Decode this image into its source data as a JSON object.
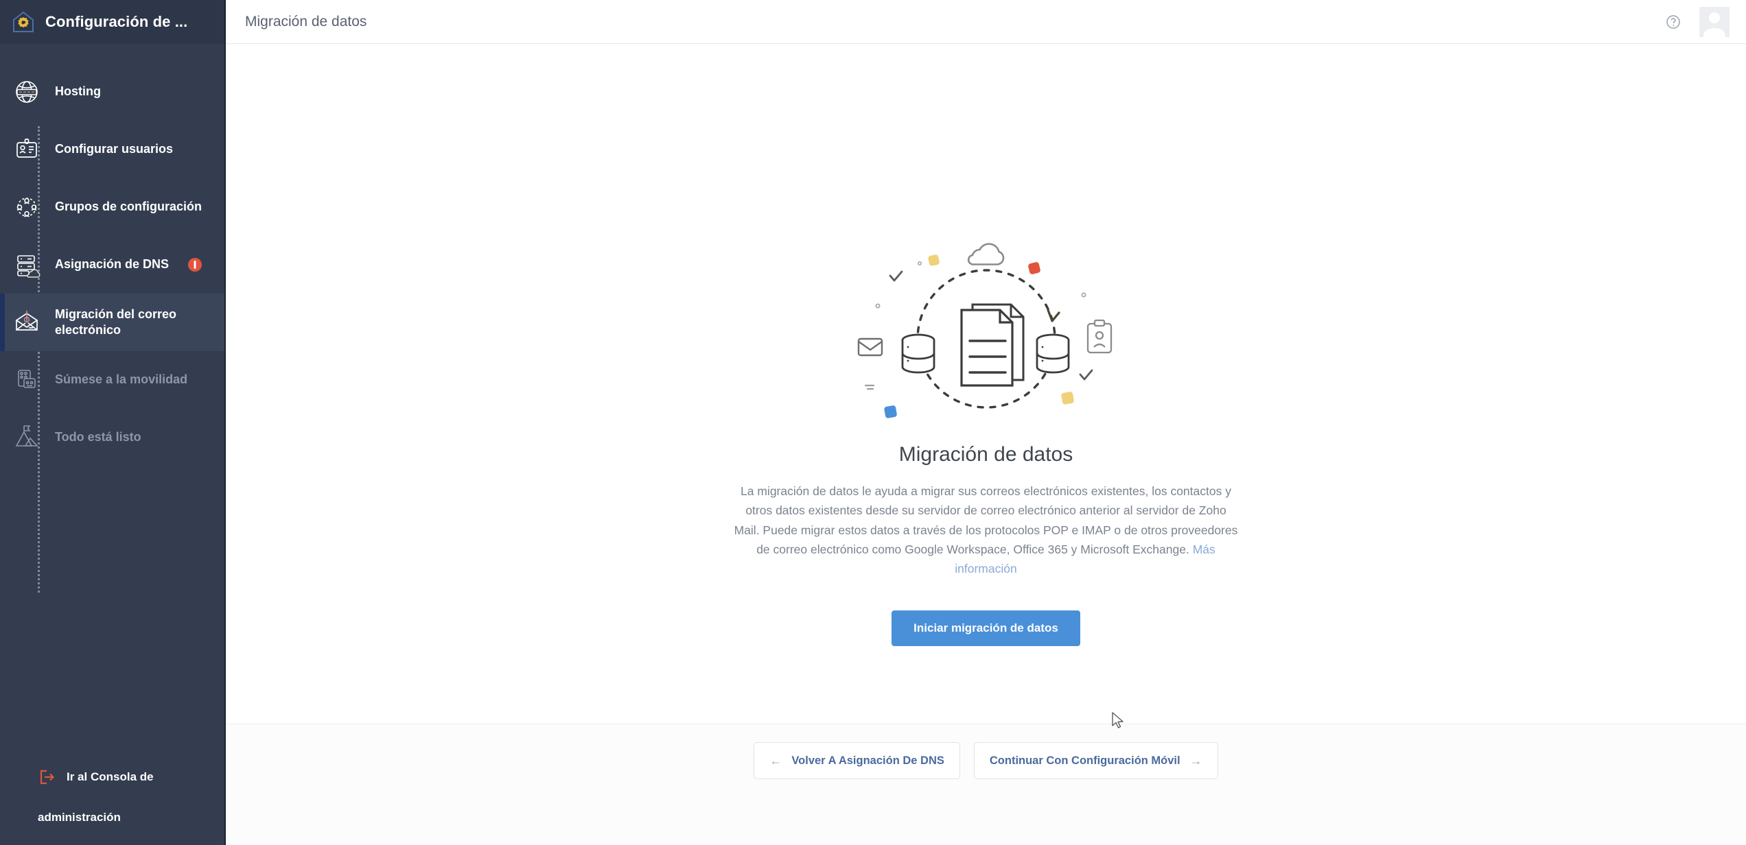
{
  "sidebar": {
    "app_title": "Configuración de ...",
    "logo_icon": "home-gear-icon",
    "steps": [
      {
        "label": "Hosting",
        "icon": "globe-icon",
        "state": "done"
      },
      {
        "label": "Configurar usuarios",
        "icon": "id-card-icon",
        "state": "done"
      },
      {
        "label": "Grupos de configuración",
        "icon": "user-group-icon",
        "state": "done"
      },
      {
        "label": "Asignación de DNS",
        "icon": "server-cloud-icon",
        "state": "done",
        "badge": "!"
      },
      {
        "label": "Migración del correo electrónico",
        "icon": "mail-migration-icon",
        "state": "active"
      },
      {
        "label": "Súmese a la movilidad",
        "icon": "mobile-devices-icon",
        "state": "pending"
      },
      {
        "label": "Todo está listo",
        "icon": "mountain-flag-icon",
        "state": "pending"
      }
    ],
    "footer_link_line1": "Ir al Consola de",
    "footer_link_line2": "administración",
    "footer_link_icon": "exit-icon"
  },
  "topbar": {
    "breadcrumb": "Migración de datos",
    "help_icon": "question-circle-icon",
    "avatar_icon": "user-avatar-icon"
  },
  "main": {
    "illustration_icon": "data-migration-illustration",
    "heading": "Migración de datos",
    "description": "La migración de datos le ayuda a migrar sus correos electrónicos existentes, los contactos y otros datos existentes desde su servidor de correo electrónico anterior al servidor de Zoho Mail. Puede migrar estos datos a través de los protocolos POP e IMAP o de otros proveedores de correo electrónico como Google Workspace, Office 365 y Microsoft Exchange.",
    "learn_more": "Más información",
    "cta_label": "Iniciar migración de datos"
  },
  "footer": {
    "back_label": "Volver A Asignación De DNS",
    "back_arrow": "←",
    "next_label": "Continuar Con Configuración Móvil",
    "next_arrow": "→"
  },
  "colors": {
    "sidebar_bg": "#333d4f",
    "sidebar_active": "#3b455a",
    "accent_bar": "#20325f",
    "primary_button": "#4a90d9",
    "badge": "#e2553d",
    "link": "#8aa9d6",
    "illus_yellow": "#f0d178",
    "illus_red": "#e2553d",
    "illus_blue": "#4a90d9"
  }
}
